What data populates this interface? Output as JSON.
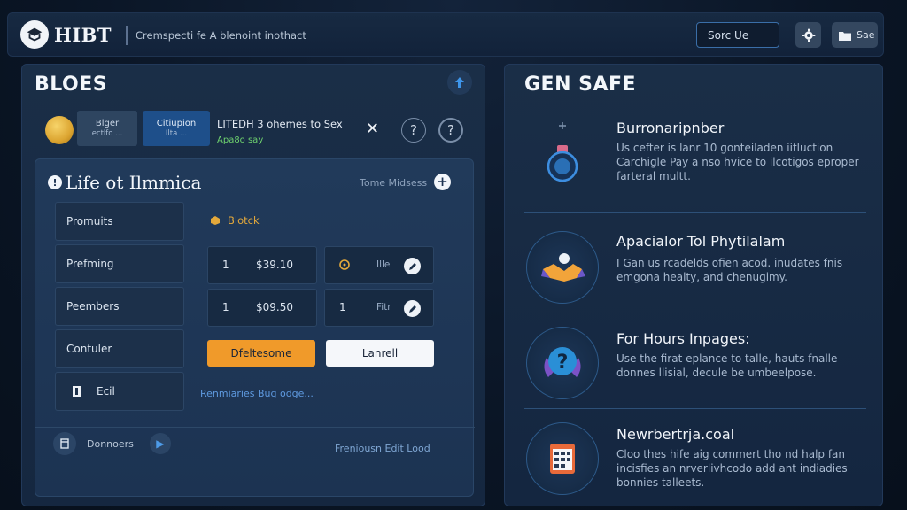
{
  "header": {
    "brand": "HIBT",
    "tagline": "Cremspecti fe A blenoint inothact",
    "search_label": "Sorc Ue",
    "save_label": "Sae"
  },
  "left": {
    "title": "BLOES",
    "pill_a": {
      "title": "Blger",
      "sub": "ectlfo ..."
    },
    "pill_b": {
      "title": "Citiupion",
      "sub": "Ilta ..."
    },
    "notice_title": "LITEDH 3 ohemes to Sex",
    "notice_sub": "Apa8o say",
    "inner_title": "Life ot Ilmmica",
    "inner_link": "Tome Midsess",
    "sidebar_items": [
      "Promuits",
      "Prefming",
      "Peembers",
      "Contuler",
      "Ecil"
    ],
    "block_label": "Blotck",
    "rows": [
      {
        "qty": "1",
        "price": "$39.10",
        "label": "Ille"
      },
      {
        "qty": "1",
        "price": "$09.50",
        "qty2": "1",
        "label": "Fitr"
      }
    ],
    "orange_button": "Dfeltesome",
    "white_button": "Lanrell",
    "foot_link": "Renmiaries Bug odge...",
    "donors_label": "Donnoers",
    "foot_right": "Freniousn Edit Lood"
  },
  "right": {
    "title": "GEN SAFE",
    "features": [
      {
        "title": "Burronaripnber",
        "desc": "Us cefter is lanr 10 gonteiladen iitluction Carchigle Pay a nso hvice to ilcotigos eproper farteral multt."
      },
      {
        "title": "Apacialor Tol Phytilalam",
        "desc": "I Gan us rcadelds ofien acod. inudates fnis emgona healty, and chenugimy."
      },
      {
        "title": "For Hours Inpages:",
        "desc": "Use the firat eplance to talle, hauts fnalle donnes llisial, decule be umbeelpose."
      },
      {
        "title": "Newrbertrja.coal",
        "desc": "Cloo thes hife aig commert tho nd halp fan incisfies an nrverlivhcodo add ant indiadies bonnies talleets."
      }
    ]
  }
}
